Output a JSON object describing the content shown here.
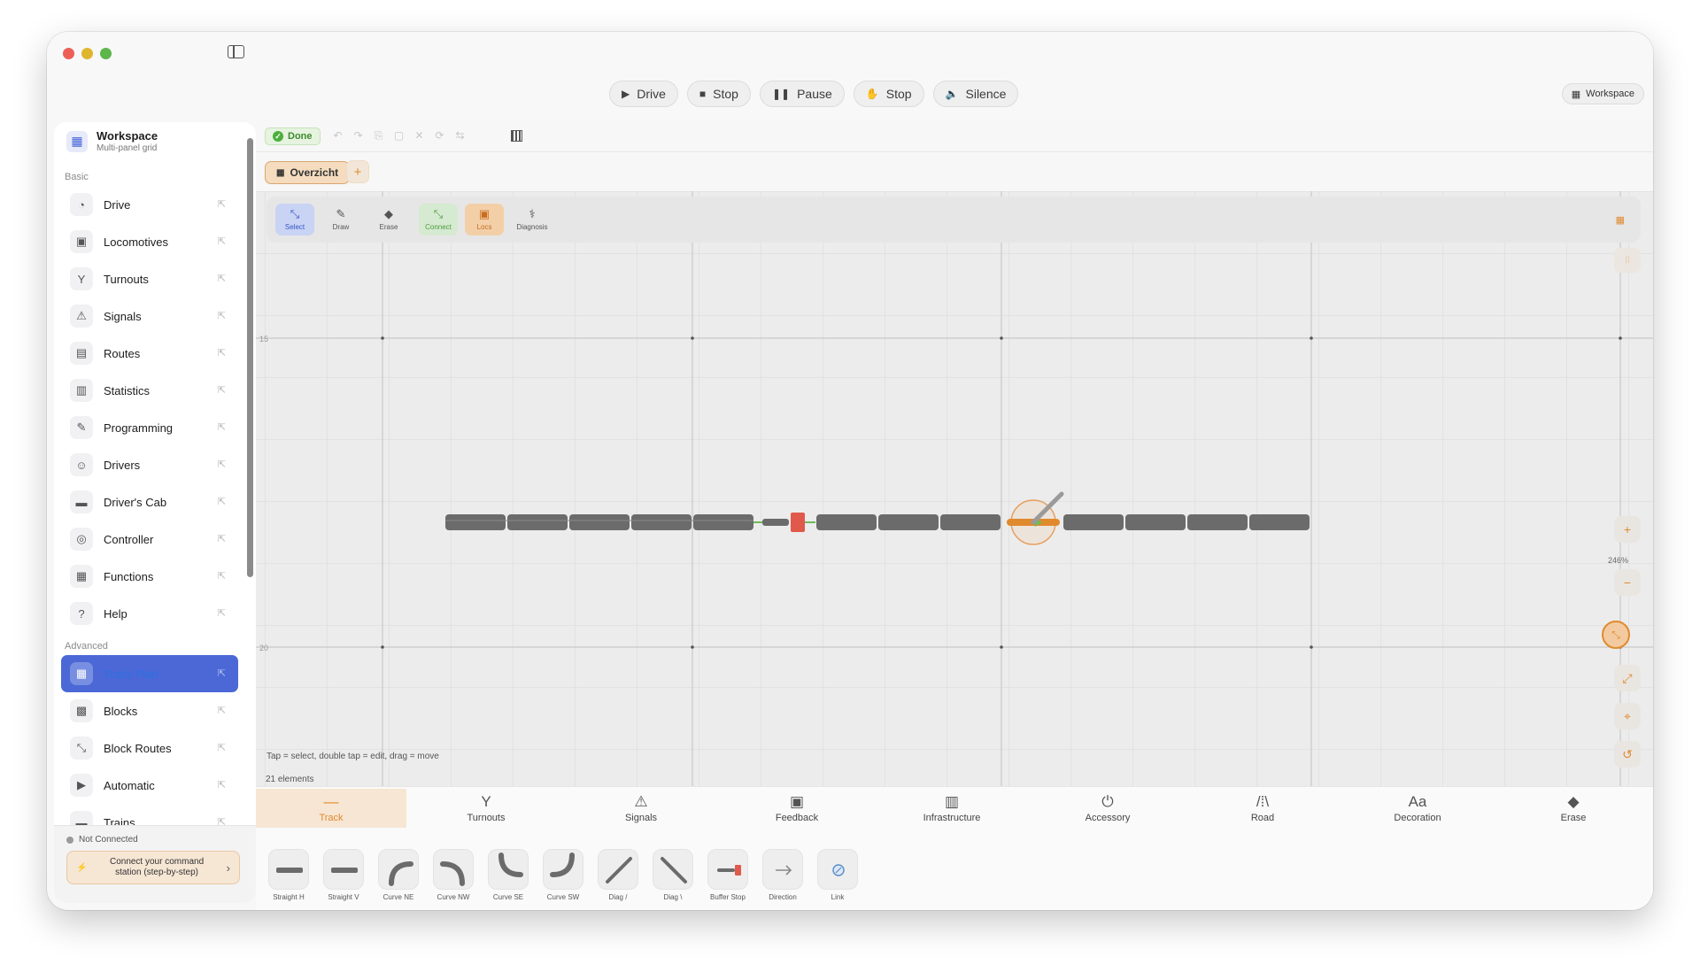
{
  "top_bar": {
    "buttons": [
      {
        "label": "Drive",
        "icon": "play-icon"
      },
      {
        "label": "Stop",
        "icon": "stop-icon"
      },
      {
        "label": "Pause",
        "icon": "pause-icon"
      },
      {
        "label": "Stop",
        "icon": "hand-icon"
      },
      {
        "label": "Silence",
        "icon": "speaker-icon"
      }
    ],
    "workspace_label": "Workspace"
  },
  "sidebar": {
    "title": "Workspace",
    "subtitle": "Multi-panel grid",
    "section_basic": "Basic",
    "basic_items": [
      {
        "label": "Drive",
        "icon": "gauge-icon"
      },
      {
        "label": "Locomotives",
        "icon": "train-icon"
      },
      {
        "label": "Turnouts",
        "icon": "turnout-icon"
      },
      {
        "label": "Signals",
        "icon": "signal-icon"
      },
      {
        "label": "Routes",
        "icon": "map-icon"
      },
      {
        "label": "Statistics",
        "icon": "bar-chart-icon"
      },
      {
        "label": "Programming",
        "icon": "tools-icon"
      },
      {
        "label": "Drivers",
        "icon": "people-icon"
      },
      {
        "label": "Driver's Cab",
        "icon": "cab-icon"
      },
      {
        "label": "Controller",
        "icon": "gamepad-icon"
      },
      {
        "label": "Functions",
        "icon": "grid-icon"
      },
      {
        "label": "Help",
        "icon": "question-icon"
      }
    ],
    "section_advanced": "Advanced",
    "advanced_items": [
      {
        "label": "Track Plan",
        "icon": "layout-icon",
        "active": true
      },
      {
        "label": "Blocks",
        "icon": "blocks-icon"
      },
      {
        "label": "Block Routes",
        "icon": "route-icon"
      },
      {
        "label": "Automatic",
        "icon": "play-box-icon"
      },
      {
        "label": "Trains",
        "icon": "train-icon"
      }
    ],
    "connection_status": "Not Connected",
    "connect_button": "Connect your command station (step-by-step)"
  },
  "editor": {
    "done_label": "Done",
    "tab_label": "Overzicht",
    "add_tab": "+"
  },
  "canvas": {
    "tools": [
      {
        "label": "Select",
        "icon": "select-icon"
      },
      {
        "label": "Draw",
        "icon": "pencil-icon"
      },
      {
        "label": "Erase",
        "icon": "eraser-icon"
      },
      {
        "label": "Connect",
        "icon": "connect-icon"
      },
      {
        "label": "Locs",
        "icon": "loco-icon"
      },
      {
        "label": "Diagnosis",
        "icon": "stethoscope-icon"
      }
    ],
    "row_labels": [
      "15",
      "20"
    ],
    "zoom_label": "246%",
    "hint": "Tap = select, double tap = edit, drag = move",
    "element_count": "21 elements"
  },
  "palette": {
    "categories": [
      {
        "label": "Track",
        "icon": "track-icon",
        "active": true
      },
      {
        "label": "Turnouts",
        "icon": "turnout-icon"
      },
      {
        "label": "Signals",
        "icon": "signal-icon"
      },
      {
        "label": "Feedback",
        "icon": "feedback-icon"
      },
      {
        "label": "Infrastructure",
        "icon": "building-icon"
      },
      {
        "label": "Accessory",
        "icon": "power-icon"
      },
      {
        "label": "Road",
        "icon": "road-icon"
      },
      {
        "label": "Decoration",
        "icon": "text-icon"
      },
      {
        "label": "Erase",
        "icon": "eraser-icon"
      }
    ],
    "pieces": [
      {
        "label": "Straight H"
      },
      {
        "label": "Straight V"
      },
      {
        "label": "Curve NE"
      },
      {
        "label": "Curve NW"
      },
      {
        "label": "Curve SE"
      },
      {
        "label": "Curve SW"
      },
      {
        "label": "Diag /"
      },
      {
        "label": "Diag \\"
      },
      {
        "label": "Buffer Stop"
      },
      {
        "label": "Direction"
      },
      {
        "label": "Link"
      }
    ]
  },
  "colors": {
    "accent": "#e08a2e",
    "selection": "#4b68d6",
    "track": "#6b6b6b",
    "buffer_stop": "#e0594a",
    "connect_green": "#4f9b40"
  }
}
